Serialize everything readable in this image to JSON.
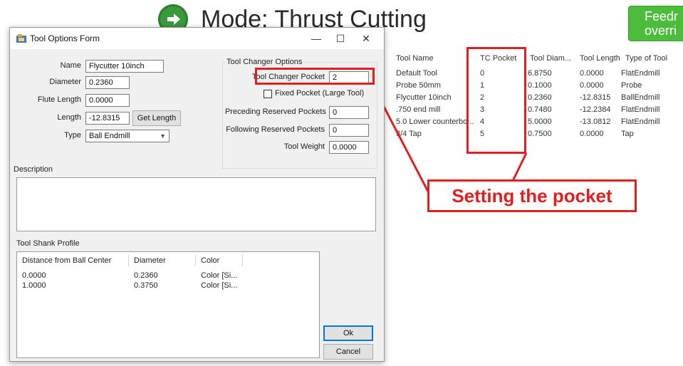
{
  "background": {
    "mode_title": "Mode: Thrust Cutting",
    "feed_button": "Feedr\noverri",
    "table": {
      "headers": [
        "Tool Name",
        "TC Pocket",
        "Tool Diam...",
        "Tool Length",
        "Type of Tool"
      ],
      "rows": [
        [
          "Default Tool",
          "0",
          "6.8750",
          "0.0000",
          "FlatEndmill"
        ],
        [
          "Probe 50mm",
          "1",
          "0.1000",
          "0.0000",
          "Probe"
        ],
        [
          "Flycutter 10inch",
          "2",
          "0.2360",
          "-12.8315",
          "BallEndmill"
        ],
        [
          ".750 end mill",
          "3",
          "0.7480",
          "-12.2384",
          "FlatEndmill"
        ],
        [
          "5.0 Lower counterbo...",
          "4",
          "5.0000",
          "-13.0812",
          "FlatEndmill"
        ],
        [
          "3/4 Tap",
          "5",
          "0.7500",
          "0.0000",
          "Tap"
        ]
      ]
    },
    "callout_text": "Setting the pocket",
    "accent_color": "#e0201e"
  },
  "dialog": {
    "title": "Tool Options Form",
    "window_controls": [
      "—",
      "☐",
      "✕"
    ],
    "fields": {
      "name_label": "Name",
      "name_value": "Flycutter 10inch",
      "diameter_label": "Diameter",
      "diameter_value": "0.2360",
      "flute_label": "Flute Length",
      "flute_value": "0.0000",
      "length_label": "Length",
      "length_value": "-12.8315",
      "get_length_button": "Get Length",
      "type_label": "Type",
      "type_value": "Ball Endmill"
    },
    "tool_changer": {
      "group_label": "Tool Changer Options",
      "pocket_label": "Tool Changer Pocket",
      "pocket_value": "2",
      "fixed_pocket_label": "Fixed Pocket (Large Tool)",
      "preceding_label": "Preceding Reserved Pockets",
      "preceding_value": "0",
      "following_label": "Following Reserved Pockets",
      "following_value": "0",
      "weight_label": "Tool Weight",
      "weight_value": "0.0000"
    },
    "description_label": "Description",
    "description_value": "",
    "shank": {
      "group_label": "Tool Shank Profile",
      "headers": [
        "Distance from Ball Center",
        "Diameter",
        "Color"
      ],
      "rows": [
        [
          "0.0000",
          "0.2360",
          "Color [Si..."
        ],
        [
          "1.0000",
          "0.3750",
          "Color [Si..."
        ]
      ]
    },
    "ok_button": "Ok",
    "cancel_button": "Cancel"
  }
}
